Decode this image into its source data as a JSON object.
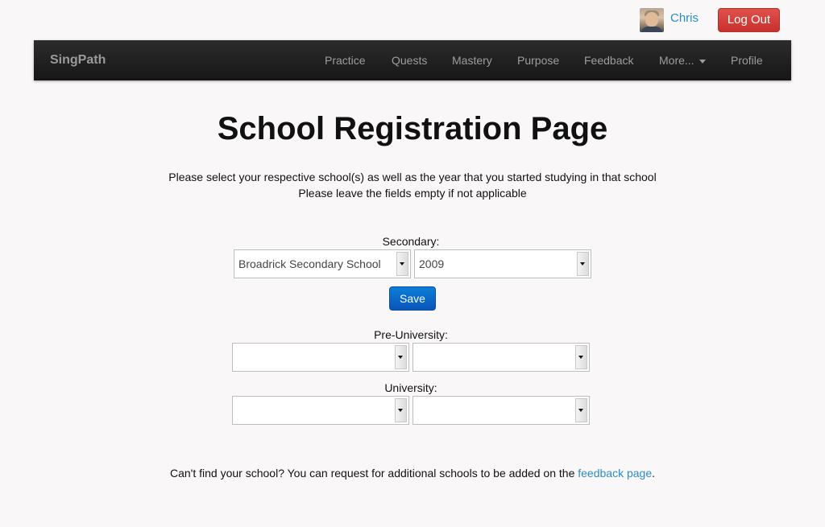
{
  "user": {
    "name": "Chris",
    "avatar_icon": "user-avatar-photo",
    "logout_label": "Log Out"
  },
  "navbar": {
    "brand": "SingPath",
    "items": [
      {
        "label": "Practice"
      },
      {
        "label": "Quests"
      },
      {
        "label": "Mastery"
      },
      {
        "label": "Purpose"
      },
      {
        "label": "Feedback"
      },
      {
        "label": "More...",
        "icon": "caret-down-icon"
      },
      {
        "label": "Profile"
      }
    ]
  },
  "main": {
    "title": "School Registration Page",
    "instruction_line1": "Please select your respective school(s) as well as the year that you started studying in that school",
    "instruction_line2": "Please leave the fields empty if not applicable",
    "secondary": {
      "label": "Secondary:",
      "school": "Broadrick Secondary School",
      "year": "2009"
    },
    "save_label": "Save",
    "pre_university": {
      "label": "Pre-University:",
      "school": "",
      "year": ""
    },
    "university": {
      "label": "University:",
      "school": "",
      "year": ""
    },
    "footer_prefix": "Can't find your school? You can request for additional schools to be added on the ",
    "footer_link": "feedback page",
    "footer_suffix": "."
  },
  "colors": {
    "link": "#2a8ec6",
    "logout_button": "#d9534f",
    "save_button": "#0a6fcf",
    "navbar": "#1e1e1e",
    "background": "#f9f7f7"
  }
}
